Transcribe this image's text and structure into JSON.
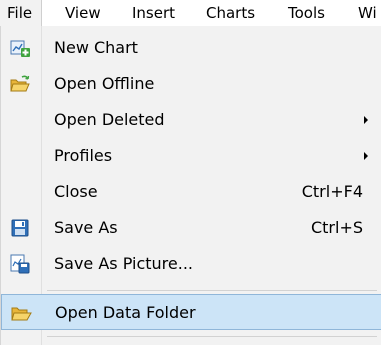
{
  "menubar": {
    "items": [
      "File",
      "View",
      "Insert",
      "Charts",
      "Tools",
      "Wi"
    ]
  },
  "menu": {
    "items": [
      {
        "label": "New Chart",
        "icon": "new-chart-icon",
        "shortcut": "",
        "submenu": false
      },
      {
        "label": "Open Offline",
        "icon": "open-folder-icon",
        "shortcut": "",
        "submenu": false
      },
      {
        "label": "Open Deleted",
        "icon": "",
        "shortcut": "",
        "submenu": true
      },
      {
        "label": "Profiles",
        "icon": "",
        "shortcut": "",
        "submenu": true
      },
      {
        "label": "Close",
        "icon": "",
        "shortcut": "Ctrl+F4",
        "submenu": false
      },
      {
        "label": "Save As",
        "icon": "floppy-disk-icon",
        "shortcut": "Ctrl+S",
        "submenu": false
      },
      {
        "label": "Save As Picture...",
        "icon": "save-picture-icon",
        "shortcut": "",
        "submenu": false
      },
      {
        "label": "Open Data Folder",
        "icon": "open-folder-icon",
        "shortcut": "",
        "submenu": false,
        "highlighted": true
      }
    ]
  },
  "colors": {
    "highlight_bg": "#cce4f7",
    "highlight_border": "#8fb6d9",
    "menu_bg": "#f2f2f2"
  }
}
